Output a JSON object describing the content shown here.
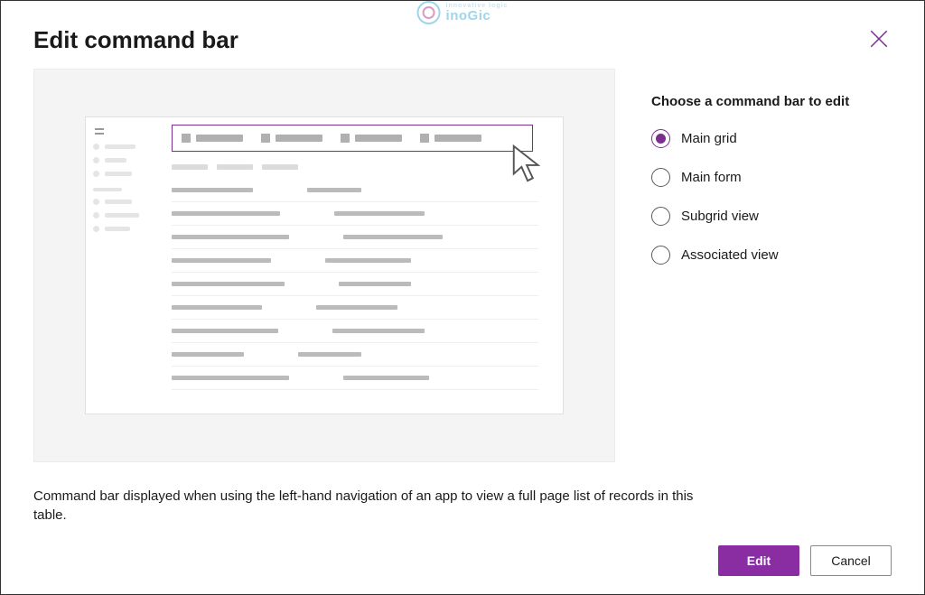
{
  "header": {
    "title": "Edit command bar"
  },
  "watermark": {
    "tagline": "innovative logic",
    "brand": "inoGic"
  },
  "options": {
    "title": "Choose a command bar to edit",
    "items": [
      {
        "label": "Main grid",
        "selected": true
      },
      {
        "label": "Main form",
        "selected": false
      },
      {
        "label": "Subgrid view",
        "selected": false
      },
      {
        "label": "Associated view",
        "selected": false
      }
    ]
  },
  "description": "Command bar displayed when using the left-hand navigation of an app to view a full page list of records in this table.",
  "footer": {
    "primary": "Edit",
    "secondary": "Cancel"
  }
}
